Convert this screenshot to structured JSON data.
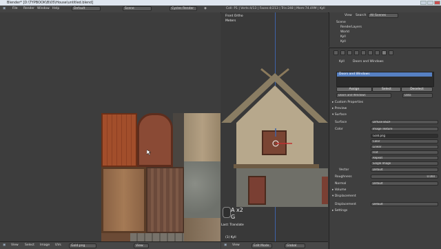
{
  "window": {
    "title": "Blender* [D:\\TYPBOOK\\B\\05\\House\\untitled.blend]"
  },
  "menubar": {
    "menus": [
      "File",
      "Render",
      "Window",
      "Help"
    ],
    "layout": "Default",
    "scene": "Scene",
    "engine": "Cycles Render",
    "stats": "Cell: P1 | Verts:4/13 | Faces:4/213 | Tris:248 | Mem:74.49M | Kyll"
  },
  "uv_editor": {
    "footer": {
      "menus": [
        "View",
        "Select",
        "Image",
        "UVs"
      ],
      "image": "Gold.png",
      "view_btn": "View"
    }
  },
  "viewport": {
    "header_line1": "Front Ortho",
    "header_line2": "Meters",
    "operator_keys": "A x2",
    "operator_key2": "G",
    "operator_hint": "Last: Translate",
    "object_label": "(1) Kyll",
    "footer": {
      "view": "View",
      "mode": "Edit Mode",
      "orientation": "Global"
    }
  },
  "outliner": {
    "menus": [
      "View",
      "Search"
    ],
    "filter": "All Scenes",
    "items": [
      "Scene",
      "RenderLayers",
      "World",
      "Kyll",
      "Kyll"
    ]
  },
  "properties": {
    "breadcrumb_obj": "Kyll",
    "breadcrumb_mat": "Doors and Windows",
    "material_slot": "Doors and Windows",
    "assign": "Assign",
    "select": "Select",
    "deselect": "Deselect",
    "material_name": "Doors and Windows",
    "data_btn": "Data",
    "sections": {
      "custom_props": "Custom Properties",
      "preview": "Preview",
      "surface": "Surface",
      "volume": "Volume",
      "displacement": "Displacement",
      "settings": "Settings"
    },
    "surface_label": "Surface",
    "surface_value": "Diffuse BSDF",
    "color_label": "Color",
    "color_value": "Image Texture",
    "image_value": "Gold.png",
    "color_space": "Color",
    "interpolation": "Linear",
    "projection": "Flat",
    "extension": "Repeat",
    "source": "Single Image",
    "vector_label": "Vector",
    "vector_value": "Default",
    "roughness_label": "Roughness",
    "roughness_value": "0.000",
    "normal_label": "Normal",
    "normal_value": "Default",
    "displacement_label": "Displacement",
    "displacement_value": "Default"
  }
}
